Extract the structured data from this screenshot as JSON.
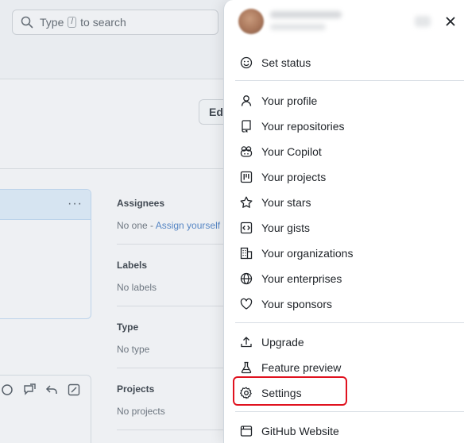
{
  "background": {
    "search": {
      "prefix": "Type",
      "key": "/",
      "suffix": "to search"
    },
    "edit_button": "Ed",
    "comment_menu": "···",
    "sidebar": [
      {
        "title": "Assignees",
        "value": "No one - ",
        "link": "Assign yourself"
      },
      {
        "title": "Labels",
        "value": "No labels",
        "link": ""
      },
      {
        "title": "Type",
        "value": "No type",
        "link": ""
      },
      {
        "title": "Projects",
        "value": "No projects",
        "link": ""
      }
    ]
  },
  "panel": {
    "close_icon": "close-icon",
    "menu": {
      "set_status": "Set status",
      "your_profile": "Your profile",
      "your_repositories": "Your repositories",
      "your_copilot": "Your Copilot",
      "your_projects": "Your projects",
      "your_stars": "Your stars",
      "your_gists": "Your gists",
      "your_organizations": "Your organizations",
      "your_enterprises": "Your enterprises",
      "your_sponsors": "Your sponsors",
      "upgrade": "Upgrade",
      "feature_preview": "Feature preview",
      "settings": "Settings",
      "github_website": "GitHub Website"
    },
    "highlight_color": "#e0121f"
  }
}
